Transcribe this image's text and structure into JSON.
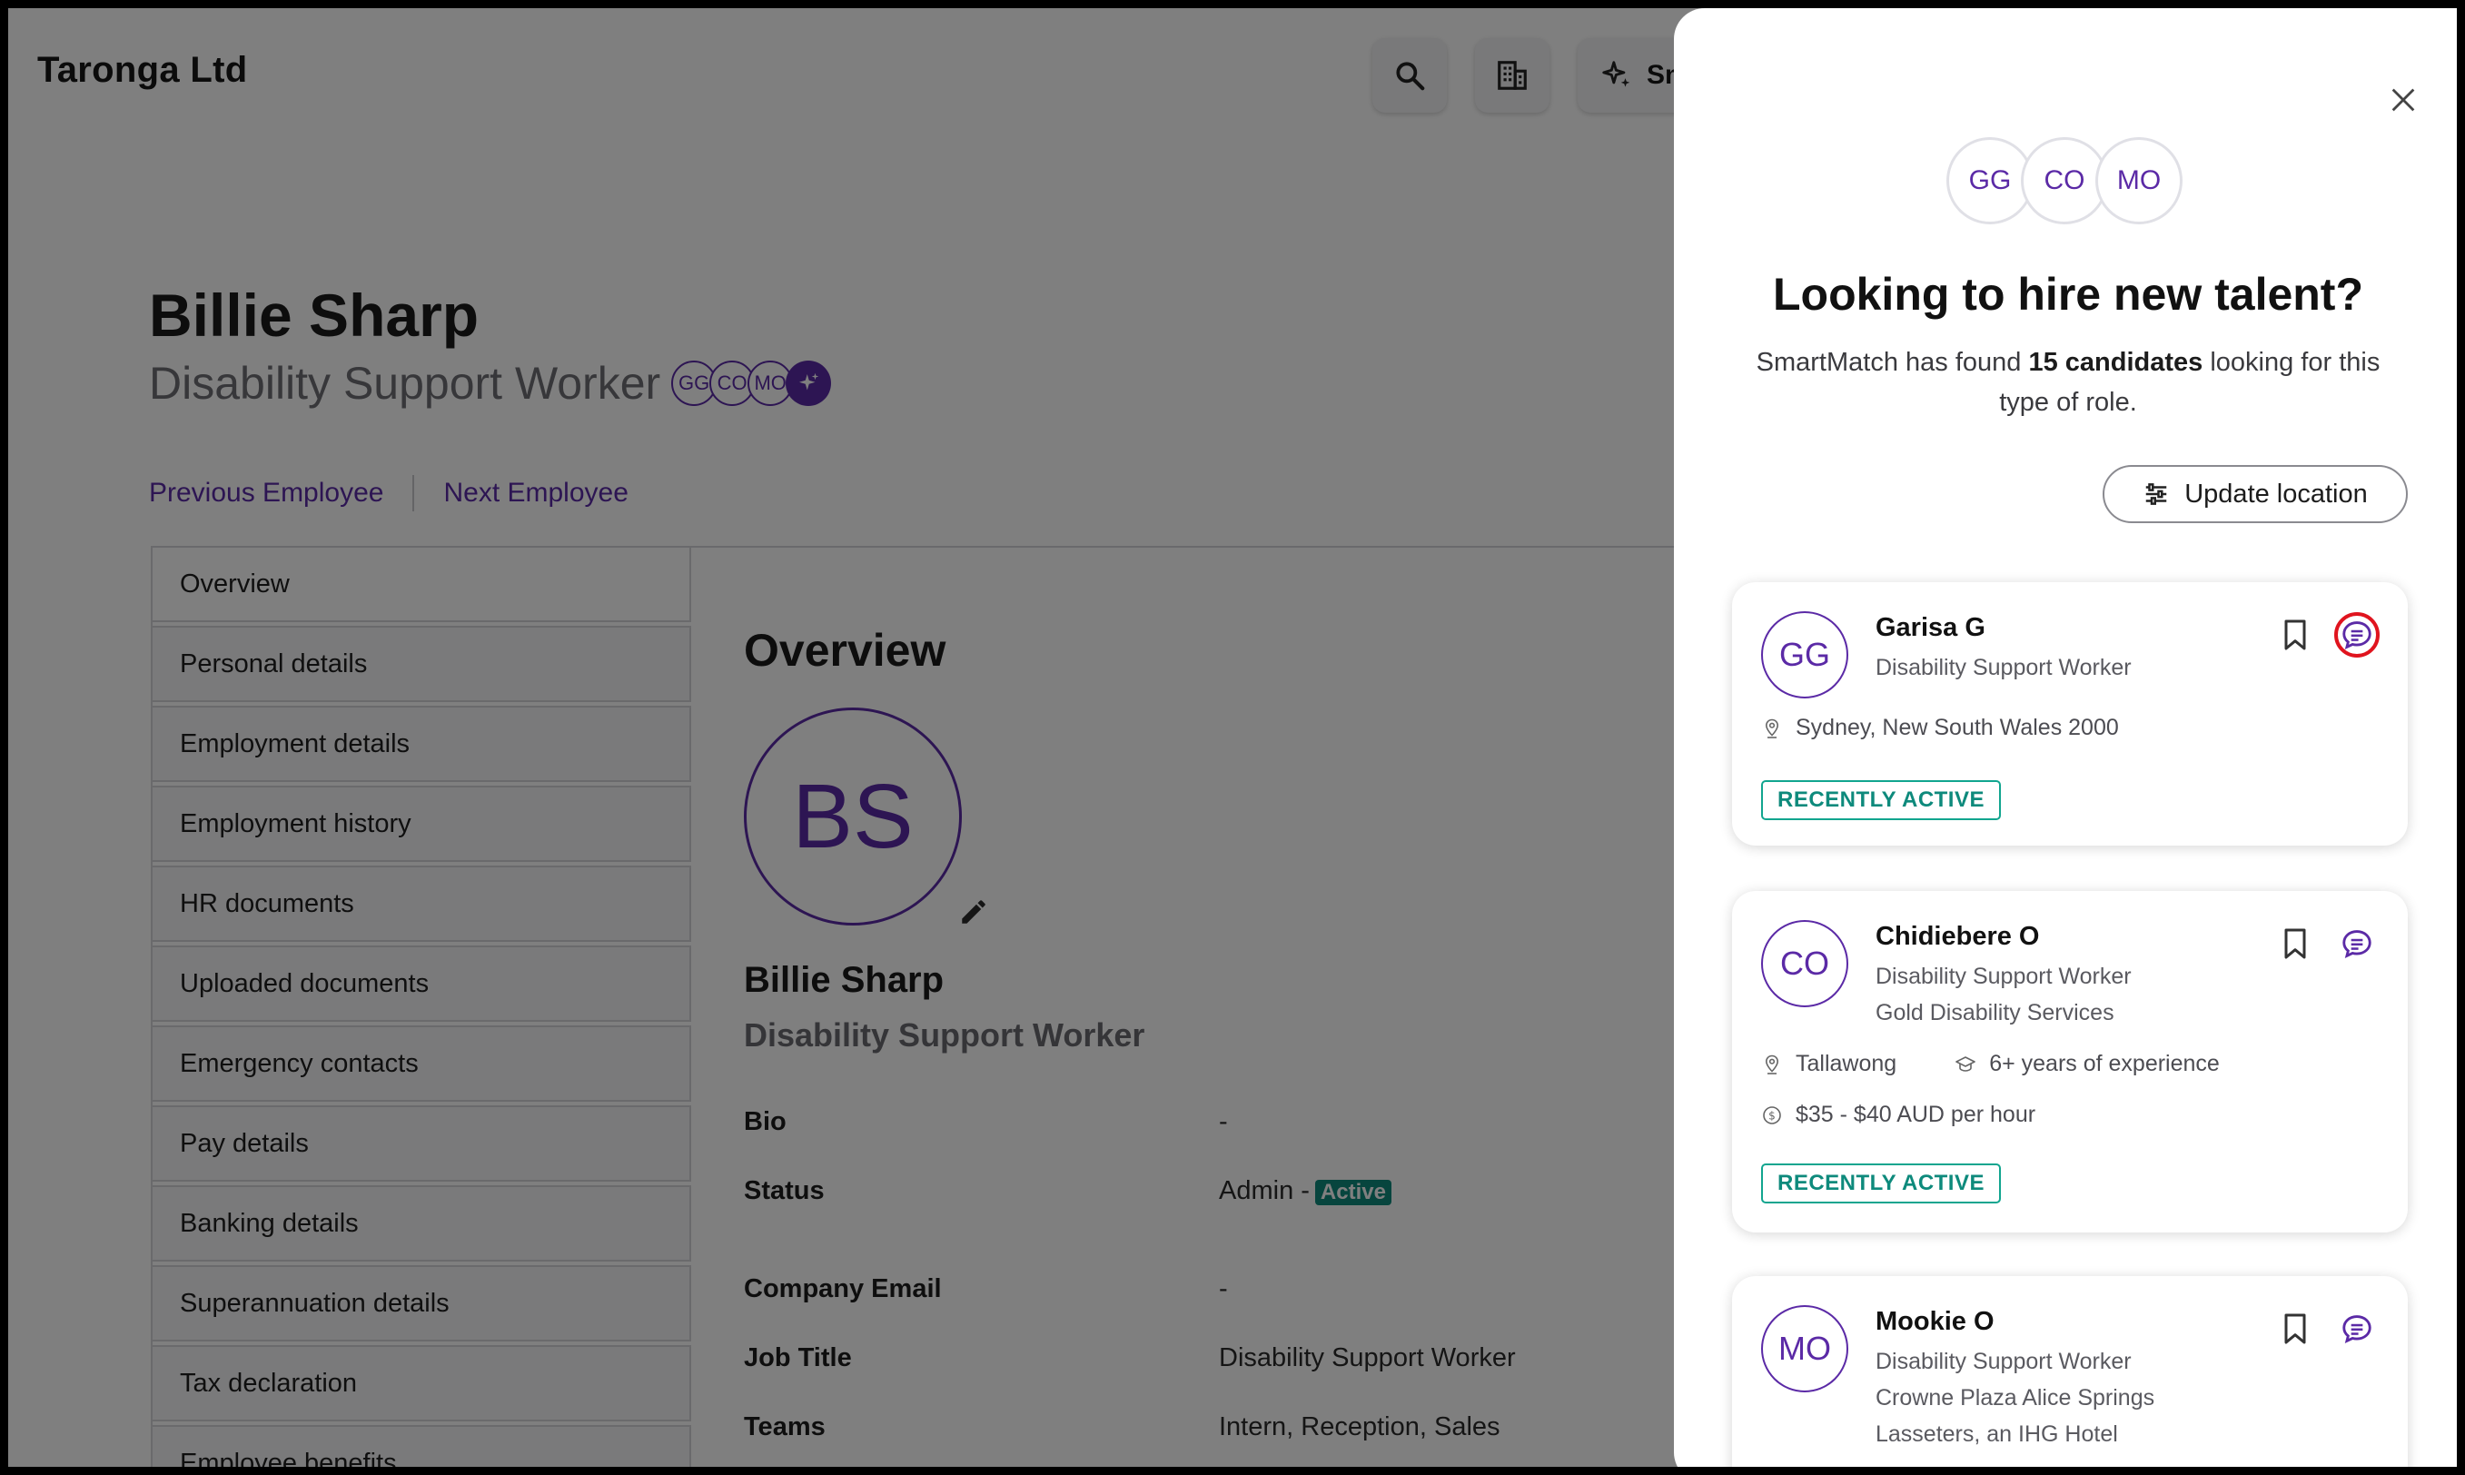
{
  "app": {
    "company": "Taronga Ltd",
    "smart_label": "Sm"
  },
  "employee": {
    "name": "Billie Sharp",
    "role": "Disability Support Worker",
    "initials": "BS",
    "mini_avatars": [
      "GG",
      "CO",
      "MO"
    ],
    "prev_label": "Previous Employee",
    "next_label": "Next Employee"
  },
  "sidebar": {
    "items": [
      "Overview",
      "Personal details",
      "Employment details",
      "Employment history",
      "HR documents",
      "Uploaded documents",
      "Emergency contacts",
      "Pay details",
      "Banking details",
      "Superannuation details",
      "Tax declaration",
      "Employee benefits"
    ]
  },
  "overview": {
    "title": "Overview",
    "name": "Billie Sharp",
    "role": "Disability Support Worker",
    "fields": {
      "bio_label": "Bio",
      "bio_value": "-",
      "status_label": "Status",
      "status_value": "Admin -",
      "status_badge": "Active",
      "email_label": "Company Email",
      "email_value": "-",
      "job_label": "Job Title",
      "job_value": "Disability Support Worker",
      "teams_label": "Teams",
      "teams_value": "Intern, Reception, Sales"
    }
  },
  "drawer": {
    "avatars": [
      "GG",
      "CO",
      "MO"
    ],
    "title": "Looking to hire new talent?",
    "sub_before": "SmartMatch has found ",
    "sub_bold": "15 candidates",
    "sub_after": " looking for this type of role.",
    "update_location": "Update location",
    "candidates": [
      {
        "initials": "GG",
        "name": "Garisa G",
        "role": "Disability Support Worker",
        "location": "Sydney, New South Wales 2000",
        "tag": "RECENTLY ACTIVE"
      },
      {
        "initials": "CO",
        "name": "Chidiebere O",
        "role": "Disability Support Worker",
        "employer": "Gold Disability Services",
        "location": "Tallawong",
        "experience": "6+ years of experience",
        "pay": "$35 - $40 AUD per hour",
        "tag": "RECENTLY ACTIVE"
      },
      {
        "initials": "MO",
        "name": "Mookie O",
        "role": "Disability Support Worker",
        "employer": "Crowne Plaza Alice Springs",
        "employer2": "Lasseters, an IHG Hotel"
      }
    ]
  },
  "colors": {
    "accent": "#5b2aa6",
    "active_green": "#0e8a7c",
    "highlight_red": "#e0141e"
  }
}
